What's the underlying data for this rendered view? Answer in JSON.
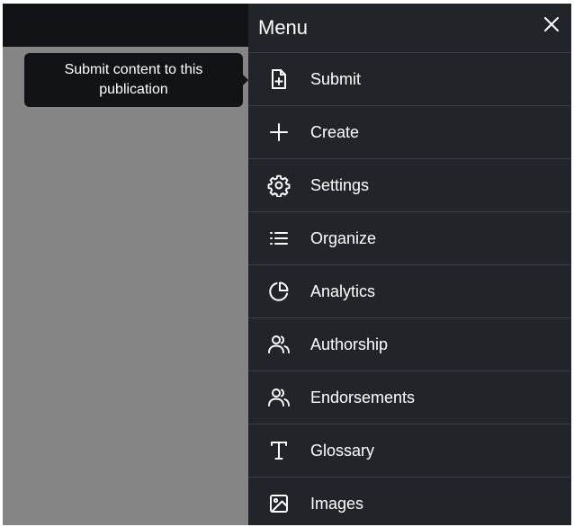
{
  "tooltip": {
    "text": "Submit content to this publication"
  },
  "menu": {
    "title": "Menu",
    "close_icon": "close-icon",
    "items": [
      {
        "label": "Submit",
        "icon": "file-plus-icon"
      },
      {
        "label": "Create",
        "icon": "plus-icon"
      },
      {
        "label": "Settings",
        "icon": "gear-icon"
      },
      {
        "label": "Organize",
        "icon": "list-icon"
      },
      {
        "label": "Analytics",
        "icon": "pie-chart-icon"
      },
      {
        "label": "Authorship",
        "icon": "users-icon"
      },
      {
        "label": "Endorsements",
        "icon": "users-icon"
      },
      {
        "label": "Glossary",
        "icon": "type-icon"
      },
      {
        "label": "Images",
        "icon": "image-icon"
      }
    ]
  },
  "colors": {
    "panel_bg": "#21252a",
    "divider": "#3a3f45",
    "overlay": "#858585",
    "topbar": "#121317"
  }
}
